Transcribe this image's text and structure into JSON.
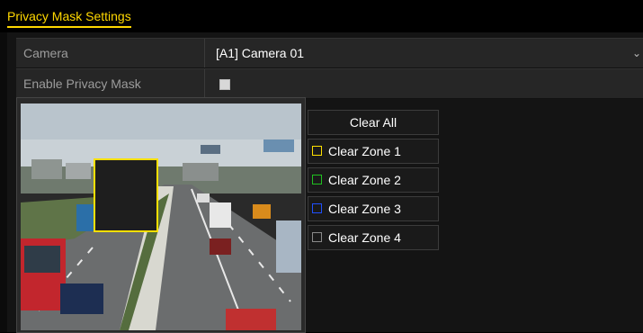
{
  "window": {
    "title": "Privacy Mask Settings"
  },
  "camera": {
    "label": "Camera",
    "value": "[A1] Camera 01"
  },
  "privacy": {
    "label": "Enable Privacy Mask",
    "checked": false
  },
  "buttons": {
    "clear_all": "Clear All",
    "zones": [
      {
        "label": "Clear Zone 1",
        "color": "#ffe000"
      },
      {
        "label": "Clear Zone 2",
        "color": "#20c020"
      },
      {
        "label": "Clear Zone 3",
        "color": "#2050ff"
      },
      {
        "label": "Clear Zone 4",
        "color": "#8a8a8a"
      }
    ]
  },
  "mask": {
    "zone": 1,
    "color": "#ffe000"
  }
}
